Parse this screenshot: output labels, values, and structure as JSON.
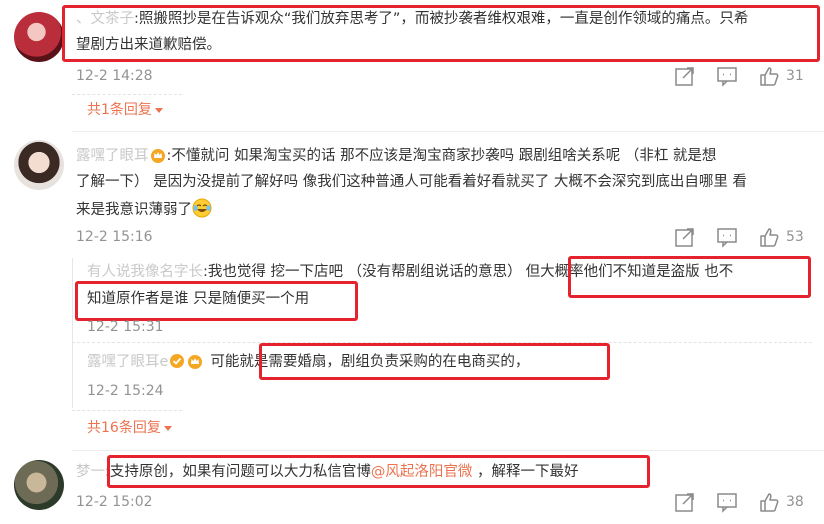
{
  "comments": [
    {
      "user": "、文茶子",
      "text_line1": ":照搬照抄是在告诉观众“我们放弃思考了”，而被抄袭者维权艰难，一直是创作领域的痛点。只希",
      "text_line2": "望剧方出来道歉赔偿。",
      "time": "12-2 14:28",
      "likes": "31",
      "replies_link": "共1条回复"
    },
    {
      "user": "露嘿了眼耳",
      "text_line1": ":不懂就问 如果淘宝买的话 那不应该是淘宝商家抄袭吗 跟剧组啥关系呢 （非杠 就是想",
      "text_line2": "了解一下） 是因为没提前了解好吗 像我们这种普通人可能看着好看就买了 大概不会深究到底出自哪里 看",
      "text_line3": "来是我意识薄弱了",
      "time": "12-2 15:16",
      "likes": "53",
      "replies": [
        {
          "user": "有人说我像名字长",
          "text_part1": ":我也觉得 挖一下店吧 （没有帮剧组说话的意思）",
          "text_part2": "但大概率他们不知道是盗版 也不",
          "text_line2": "知道原作者是谁 只是随便买一个用",
          "time": "12-2 15:31"
        },
        {
          "user": "露嘿了眼耳e",
          "text": "可能就是需要婚扇，剧组负责采购的在电商买的，",
          "time": "12-2 15:24"
        }
      ],
      "replies_link": "共16条回复"
    },
    {
      "user": "梦一",
      "text_part1": ":支持原创，如果有问题可以大力私信官博",
      "mention": "@风起洛阳官微",
      "text_part2": " ，解释一下最好",
      "time": "12-2 15:02",
      "likes": "38"
    }
  ],
  "icons": [
    "share-icon",
    "comment-icon",
    "like-icon",
    "emoji-icon",
    "crown-badge-icon",
    "verified-badge-icon"
  ],
  "colors": {
    "highlight": "#e5232e",
    "link": "#eb7350",
    "meta": "#939393"
  }
}
